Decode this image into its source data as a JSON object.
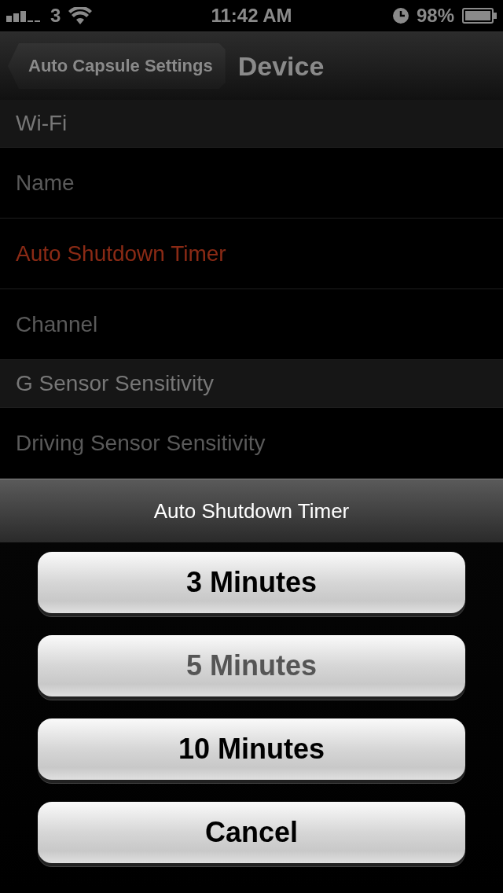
{
  "status_bar": {
    "carrier": "3",
    "time": "11:42 AM",
    "battery": "98%"
  },
  "nav": {
    "back": "Auto Capsule Settings",
    "title": "Device"
  },
  "rows": [
    {
      "kind": "header",
      "label": "Wi-Fi",
      "selected": false
    },
    {
      "kind": "item",
      "label": "Name",
      "selected": false
    },
    {
      "kind": "item",
      "label": "Auto Shutdown Timer",
      "selected": true
    },
    {
      "kind": "item",
      "label": "Channel",
      "selected": false
    },
    {
      "kind": "header",
      "label": "G Sensor Sensitivity",
      "selected": false
    },
    {
      "kind": "item",
      "label": "Driving Sensor Sensitivity",
      "selected": false
    }
  ],
  "action_sheet": {
    "title": "Auto Shutdown Timer",
    "buttons": [
      {
        "label": "3 Minutes",
        "selected": false
      },
      {
        "label": "5 Minutes",
        "selected": true
      },
      {
        "label": "10 Minutes",
        "selected": false
      },
      {
        "label": "Cancel",
        "selected": false
      }
    ]
  }
}
